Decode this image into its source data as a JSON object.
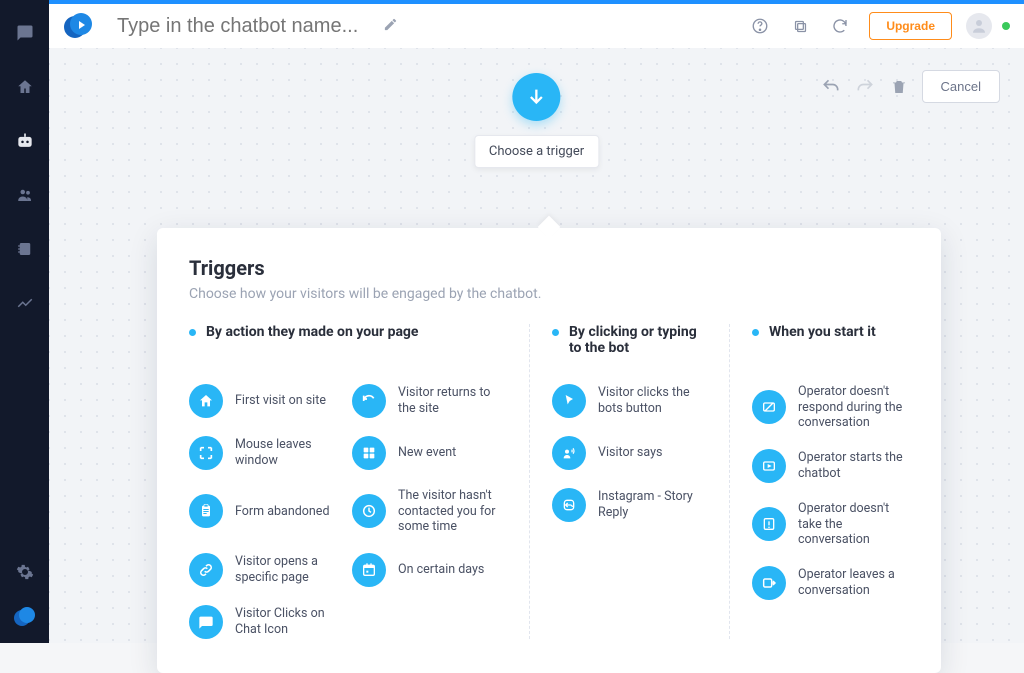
{
  "topbar": {
    "chatbot_name_placeholder": "Type in the chatbot name...",
    "upgrade_label": "Upgrade"
  },
  "toolbar": {
    "cancel_label": "Cancel"
  },
  "start_node": {
    "label": "Choose a trigger"
  },
  "panel": {
    "title": "Triggers",
    "subtitle": "Choose how your visitors will be engaged by the chatbot.",
    "columns": [
      {
        "header": "By action they made on your page"
      },
      {
        "header": "By clicking or typing to the bot"
      },
      {
        "header": "When you start it"
      }
    ],
    "col1": [
      {
        "label": "First visit on site",
        "icon": "home-icon"
      },
      {
        "label": "Visitor returns to the site",
        "icon": "refresh-icon"
      },
      {
        "label": "Mouse leaves window",
        "icon": "expand-icon"
      },
      {
        "label": "New event",
        "icon": "grid-icon"
      },
      {
        "label": "Form abandoned",
        "icon": "clipboard-icon"
      },
      {
        "label": "The visitor hasn't contacted you for some time",
        "icon": "clock-icon"
      },
      {
        "label": "Visitor opens a specific page",
        "icon": "link-icon"
      },
      {
        "label": "On certain days",
        "icon": "calendar-icon"
      },
      {
        "label": "Visitor Clicks on Chat Icon",
        "icon": "chat-icon"
      }
    ],
    "col2": [
      {
        "label": "Visitor clicks the bots button",
        "icon": "cursor-icon"
      },
      {
        "label": "Visitor says",
        "icon": "speaker-icon"
      },
      {
        "label": "Instagram - Story Reply",
        "icon": "reply-icon"
      }
    ],
    "col3": [
      {
        "label": "Operator doesn't respond during the conversation",
        "icon": "no-response-icon"
      },
      {
        "label": "Operator starts the chatbot",
        "icon": "play-window-icon"
      },
      {
        "label": "Operator doesn't take the conversation",
        "icon": "warning-icon"
      },
      {
        "label": "Operator leaves a conversation",
        "icon": "leave-icon"
      }
    ]
  }
}
